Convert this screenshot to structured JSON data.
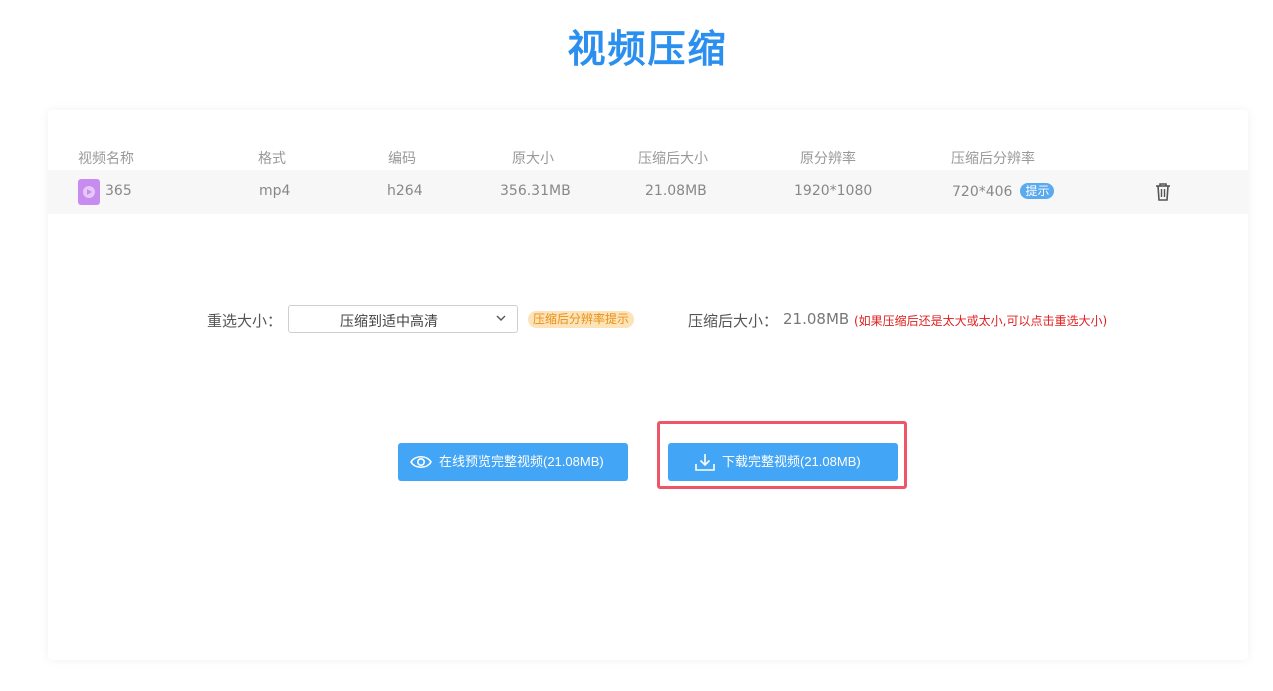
{
  "page": {
    "title": "视频压缩"
  },
  "table": {
    "headers": {
      "name": "视频名称",
      "format": "格式",
      "codec": "编码",
      "orig_size": "原大小",
      "comp_size": "压缩后大小",
      "orig_res": "原分辨率",
      "comp_res": "压缩后分辨率"
    },
    "rows": [
      {
        "name": "365",
        "format": "mp4",
        "codec": "h264",
        "orig_size": "356.31MB",
        "comp_size": "21.08MB",
        "orig_res": "1920*1080",
        "comp_res": "720*406",
        "hint": "提示"
      }
    ]
  },
  "resize": {
    "label": "重选大小：",
    "selected": "压缩到适中高清",
    "res_hint": "压缩后分辨率提示",
    "after_label": "压缩后大小：",
    "after_value": "21.08MB",
    "after_note": "(如果压缩后还是太大或太小,可以点击重选大小)"
  },
  "buttons": {
    "preview": "在线预览完整视频(21.08MB)",
    "download": "下载完整视频(21.08MB)"
  },
  "colors": {
    "accent": "#43a5f5",
    "title": "#2b8ff0",
    "warning": "#e02020",
    "highlight": "#ee5566"
  }
}
